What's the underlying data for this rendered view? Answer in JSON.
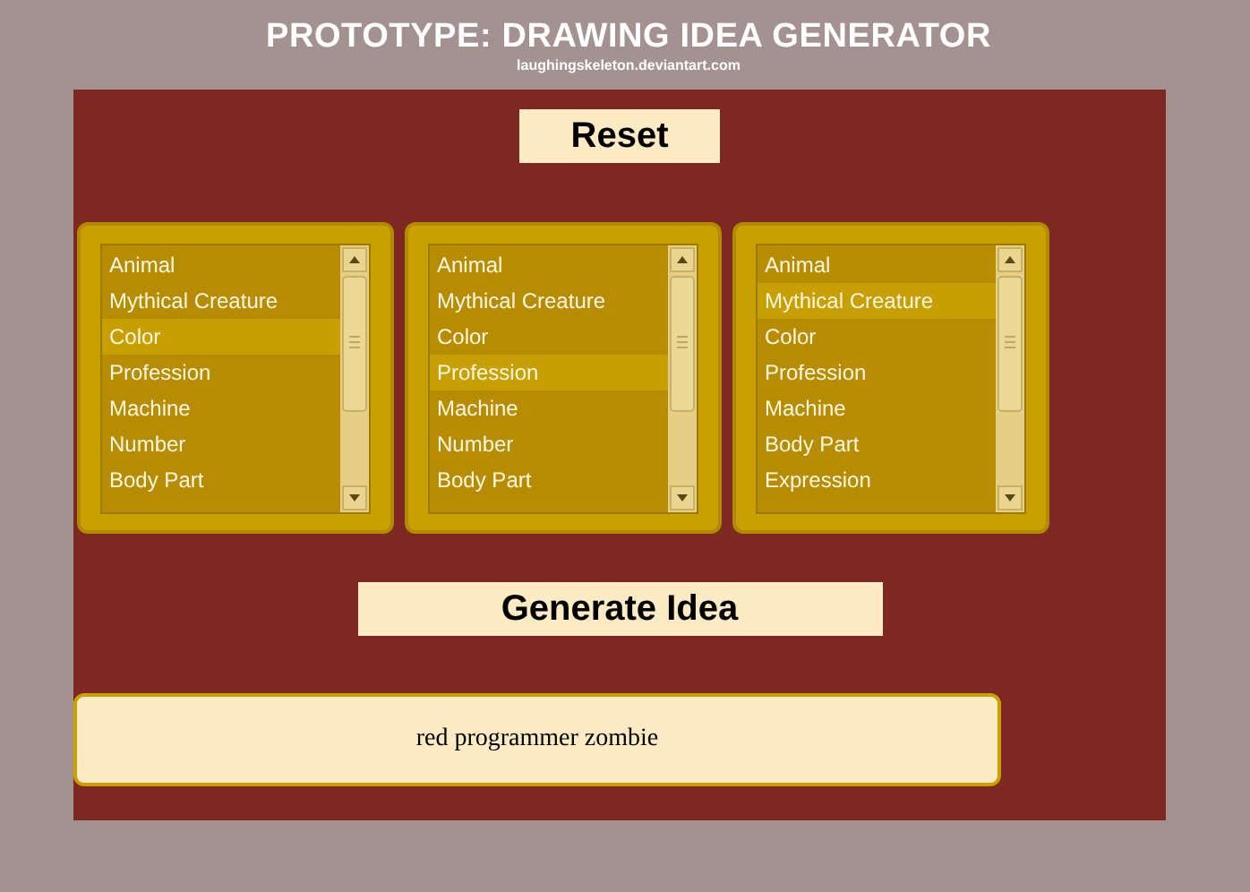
{
  "title": "PROTOTYPE: DRAWING IDEA GENERATOR",
  "subtitle": "laughingskeleton.deviantart.com",
  "reset_button": "Reset",
  "lists": [
    {
      "items": [
        {
          "label": "Animal",
          "selected": false
        },
        {
          "label": "Mythical Creature",
          "selected": false
        },
        {
          "label": "Color",
          "selected": true
        },
        {
          "label": "Profession",
          "selected": false
        },
        {
          "label": "Machine",
          "selected": false
        },
        {
          "label": "Number",
          "selected": false
        },
        {
          "label": "Body Part",
          "selected": false
        }
      ]
    },
    {
      "items": [
        {
          "label": "Animal",
          "selected": false
        },
        {
          "label": "Mythical Creature",
          "selected": false
        },
        {
          "label": "Color",
          "selected": false
        },
        {
          "label": "Profession",
          "selected": true
        },
        {
          "label": "Machine",
          "selected": false
        },
        {
          "label": "Number",
          "selected": false
        },
        {
          "label": "Body Part",
          "selected": false
        }
      ]
    },
    {
      "items": [
        {
          "label": "Animal",
          "selected": false
        },
        {
          "label": "Mythical Creature",
          "selected": true
        },
        {
          "label": "Color",
          "selected": false
        },
        {
          "label": "Profession",
          "selected": false
        },
        {
          "label": "Machine",
          "selected": false
        },
        {
          "label": "Body Part",
          "selected": false
        },
        {
          "label": "Expression",
          "selected": false
        }
      ]
    }
  ],
  "generate_button": "Generate Idea",
  "result": "red programmer zombie"
}
